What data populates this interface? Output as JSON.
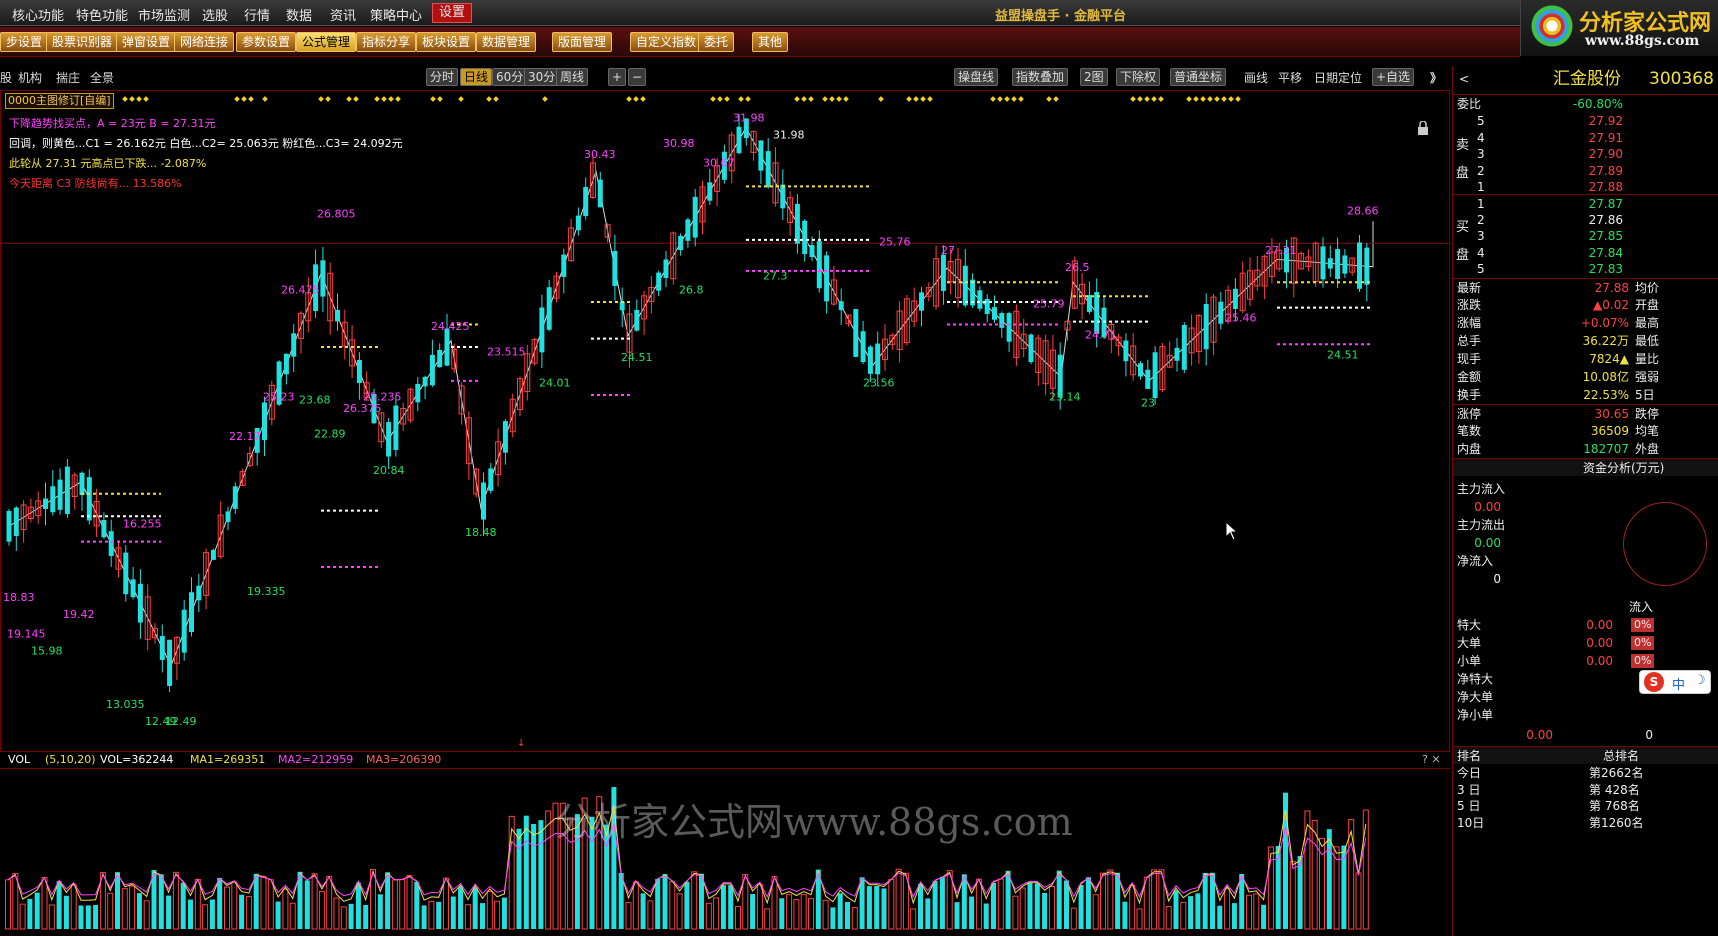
{
  "menu": {
    "items": [
      "核心功能",
      "特色功能",
      "市场监测",
      "选股",
      "行情",
      "数据",
      "资讯",
      "策略中心",
      "设置"
    ],
    "active": "设置",
    "app_title": "益盟操盘手 · 金融平台"
  },
  "logo": {
    "cn": "分析家公式网",
    "url": "www.88gs.com"
  },
  "toolbar": {
    "items": [
      "步设置",
      "股票识别器",
      "弹窗设置",
      "网络连接",
      "参数设置",
      "公式管理",
      "指标分享",
      "板块设置",
      "数据管理",
      "版面管理",
      "自定义指数",
      "委托",
      "其他"
    ],
    "selected": "公式管理"
  },
  "chart_toolbar": {
    "left_items": [
      "股",
      "机构",
      "揣庄",
      "全景"
    ],
    "periods": [
      "分时",
      "日线",
      "60分",
      "30分",
      "周线"
    ],
    "selected_period": "日线",
    "zoom_in": "+",
    "zoom_out": "−",
    "right_items": [
      "操盘线",
      "指数叠加",
      "2图",
      "下除权",
      "普通坐标",
      "画线",
      "平移",
      "日期定位",
      "+自选"
    ],
    "collapse": "》"
  },
  "indicator": {
    "dropdown": "0000主图修订[自编]",
    "line1": "下降趋势找买点，A  = 23元    B  = 27.31元",
    "line2": "回调，则黄色...C1 = 26.162元     白色...C2= 25.063元    粉红色...C3= 24.092元",
    "line3": "此轮从  27.31  元高点已下跌...  -2.087%",
    "line4": "今天距离 C3 防线尚有...  13.586%"
  },
  "price_labels": {
    "peaks": [
      {
        "t": "19.145",
        "c": "mag"
      },
      {
        "t": "18.83",
        "c": "mag"
      },
      {
        "t": "19.42",
        "c": "mag"
      },
      {
        "t": "16.255",
        "c": "mag"
      },
      {
        "t": "22.17",
        "c": "mag"
      },
      {
        "t": "25.23",
        "c": "mag"
      },
      {
        "t": "26.475",
        "c": "mag"
      },
      {
        "t": "26.805",
        "c": "mag"
      },
      {
        "t": "26.375",
        "c": "mag"
      },
      {
        "t": "25.235",
        "c": "mag"
      },
      {
        "t": "24.425",
        "c": "mag"
      },
      {
        "t": "23.515",
        "c": "mag"
      },
      {
        "t": "30.43",
        "c": "mag"
      },
      {
        "t": "30.98",
        "c": "mag"
      },
      {
        "t": "30.67",
        "c": "mag"
      },
      {
        "t": "31.98",
        "c": "mag"
      },
      {
        "t": "31.98",
        "c": "wht"
      },
      {
        "t": "25.76",
        "c": "mag"
      },
      {
        "t": "27",
        "c": "mag"
      },
      {
        "t": "26.5",
        "c": "mag"
      },
      {
        "t": "25.79",
        "c": "mag"
      },
      {
        "t": "24.71",
        "c": "mag"
      },
      {
        "t": "25.46",
        "c": "mag"
      },
      {
        "t": "27.31",
        "c": "mag"
      },
      {
        "t": "28.66",
        "c": "mag"
      }
    ],
    "troughs": [
      {
        "t": "15.98",
        "c": "grn"
      },
      {
        "t": "13.035",
        "c": "grn"
      },
      {
        "t": "12.49",
        "c": "grn"
      },
      {
        "t": "12.49",
        "c": "grn"
      },
      {
        "t": "19.335",
        "c": "grn"
      },
      {
        "t": "23.68",
        "c": "grn"
      },
      {
        "t": "22.89",
        "c": "grn"
      },
      {
        "t": "20.84",
        "c": "grn"
      },
      {
        "t": "18.48",
        "c": "grn"
      },
      {
        "t": "24.01",
        "c": "grn"
      },
      {
        "t": "24.51",
        "c": "grn"
      },
      {
        "t": "26.8",
        "c": "grn"
      },
      {
        "t": "27.3",
        "c": "grn"
      },
      {
        "t": "23.56",
        "c": "grn"
      },
      {
        "t": "23.14",
        "c": "grn"
      },
      {
        "t": "23",
        "c": "grn"
      },
      {
        "t": "24.51",
        "c": "grn"
      }
    ]
  },
  "volume": {
    "label": "VOL",
    "params": "(5,10,20)",
    "vol": "VOL=362244",
    "ma1": "MA1=269351",
    "ma2": "MA2=212959",
    "ma3": "MA3=206390",
    "controls": "? ✕"
  },
  "watermark": "分析家公式网www.88gs.com",
  "stock": {
    "name": "汇金股份",
    "code": "300368",
    "weibi_label": "委比",
    "weibi": "-60.80%",
    "sell_label": "卖盘",
    "buy_label": "买盘",
    "sell": [
      {
        "n": "5",
        "p": "27.92"
      },
      {
        "n": "4",
        "p": "27.91"
      },
      {
        "n": "3",
        "p": "27.90"
      },
      {
        "n": "2",
        "p": "27.89"
      },
      {
        "n": "1",
        "p": "27.88"
      }
    ],
    "buy": [
      {
        "n": "1",
        "p": "27.87"
      },
      {
        "n": "2",
        "p": "27.86"
      },
      {
        "n": "3",
        "p": "27.85"
      },
      {
        "n": "4",
        "p": "27.84"
      },
      {
        "n": "5",
        "p": "27.83"
      }
    ],
    "quote": [
      {
        "k": "最新",
        "v": "27.88",
        "c": "red",
        "k2": "均价"
      },
      {
        "k": "涨跌",
        "v": "▲0.02",
        "c": "red",
        "k2": "开盘"
      },
      {
        "k": "涨幅",
        "v": "+0.07%",
        "c": "red",
        "k2": "最高"
      },
      {
        "k": "总手",
        "v": "36.22万",
        "c": "yel",
        "k2": "最低"
      },
      {
        "k": "现手",
        "v": "7824▲",
        "c": "yel",
        "k2": "量比"
      },
      {
        "k": "金额",
        "v": "10.08亿",
        "c": "yel",
        "k2": "强弱"
      },
      {
        "k": "换手",
        "v": "22.53%",
        "c": "yel",
        "k2": "5日"
      },
      {
        "k": "涨停",
        "v": "30.65",
        "c": "red",
        "k2": "跌停"
      },
      {
        "k": "笔数",
        "v": "36509",
        "c": "yel",
        "k2": "均笔"
      },
      {
        "k": "内盘",
        "v": "182707",
        "c": "grn",
        "k2": "外盘"
      }
    ],
    "fund_title": "资金分析(万元)",
    "fund": [
      {
        "k": "主力流入",
        "v": "0.00",
        "c": "red"
      },
      {
        "k": "主力流出",
        "v": "0.00",
        "c": "grn"
      },
      {
        "k": "净流入",
        "v": "0",
        "c": "wht"
      }
    ],
    "flow_title": "流入",
    "flow": [
      {
        "k": "特大",
        "v": "0.00",
        "pct": "0%"
      },
      {
        "k": "大单",
        "v": "0.00",
        "pct": "0%"
      },
      {
        "k": "小单",
        "v": "0.00",
        "pct": "0%"
      }
    ],
    "net": [
      "净特大",
      "净大单",
      "净小单"
    ],
    "net_total_left": "0.00",
    "net_total_right": "0",
    "ime": "中",
    "rank_head": [
      "排名",
      "总排名"
    ],
    "rank": [
      {
        "k": "今日",
        "v": "第2662名"
      },
      {
        "k": "3 日",
        "v": "第  428名"
      },
      {
        "k": "5 日",
        "v": "第  768名"
      },
      {
        "k": "10日",
        "v": "第1260名"
      }
    ]
  },
  "colors": {
    "up": "#ff4040",
    "down": "#20e0e0",
    "accent": "#c89a20"
  }
}
